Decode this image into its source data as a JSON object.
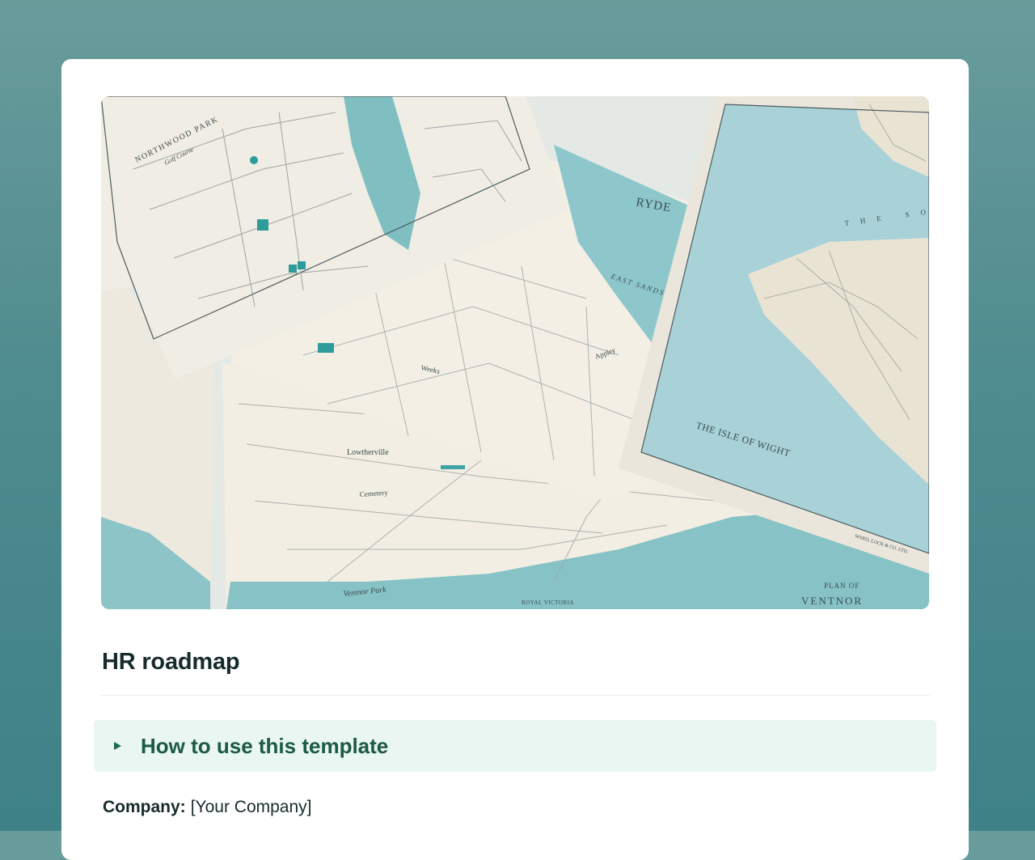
{
  "page": {
    "title": "HR roadmap",
    "cover_image": "maps-photo",
    "expand_section": {
      "label": "How to use this template",
      "icon": "caret-right-icon",
      "state": "collapsed"
    },
    "fields": [
      {
        "key": "Company:",
        "value": "[Your Company]"
      }
    ]
  },
  "cover_labels": {
    "northwood": "NORTHWOOD PARK",
    "golf": "Golf Course",
    "ryde": "RYDE",
    "east_sands": "EAST SANDS",
    "weeks": "Weeks",
    "appley": "Appley",
    "isle": "THE ISLE OF WIGHT",
    "lowtherville": "Lowtherville",
    "cemetery": "Cemetery",
    "plan_of": "PLAN OF",
    "ventnor": "VENTNOR",
    "ventnor_park": "Ventnor Park",
    "royal_victoria": "ROYAL VICTORIA",
    "solent": "THE SO",
    "publisher": "WARD, LOCK & CO. LTD."
  },
  "colors": {
    "background": "#4f8c8f",
    "accent": "#1c5a45",
    "expand_bg": "#e9f6f1",
    "sea": "#8fc6c9",
    "paper": "#f1ede2"
  }
}
